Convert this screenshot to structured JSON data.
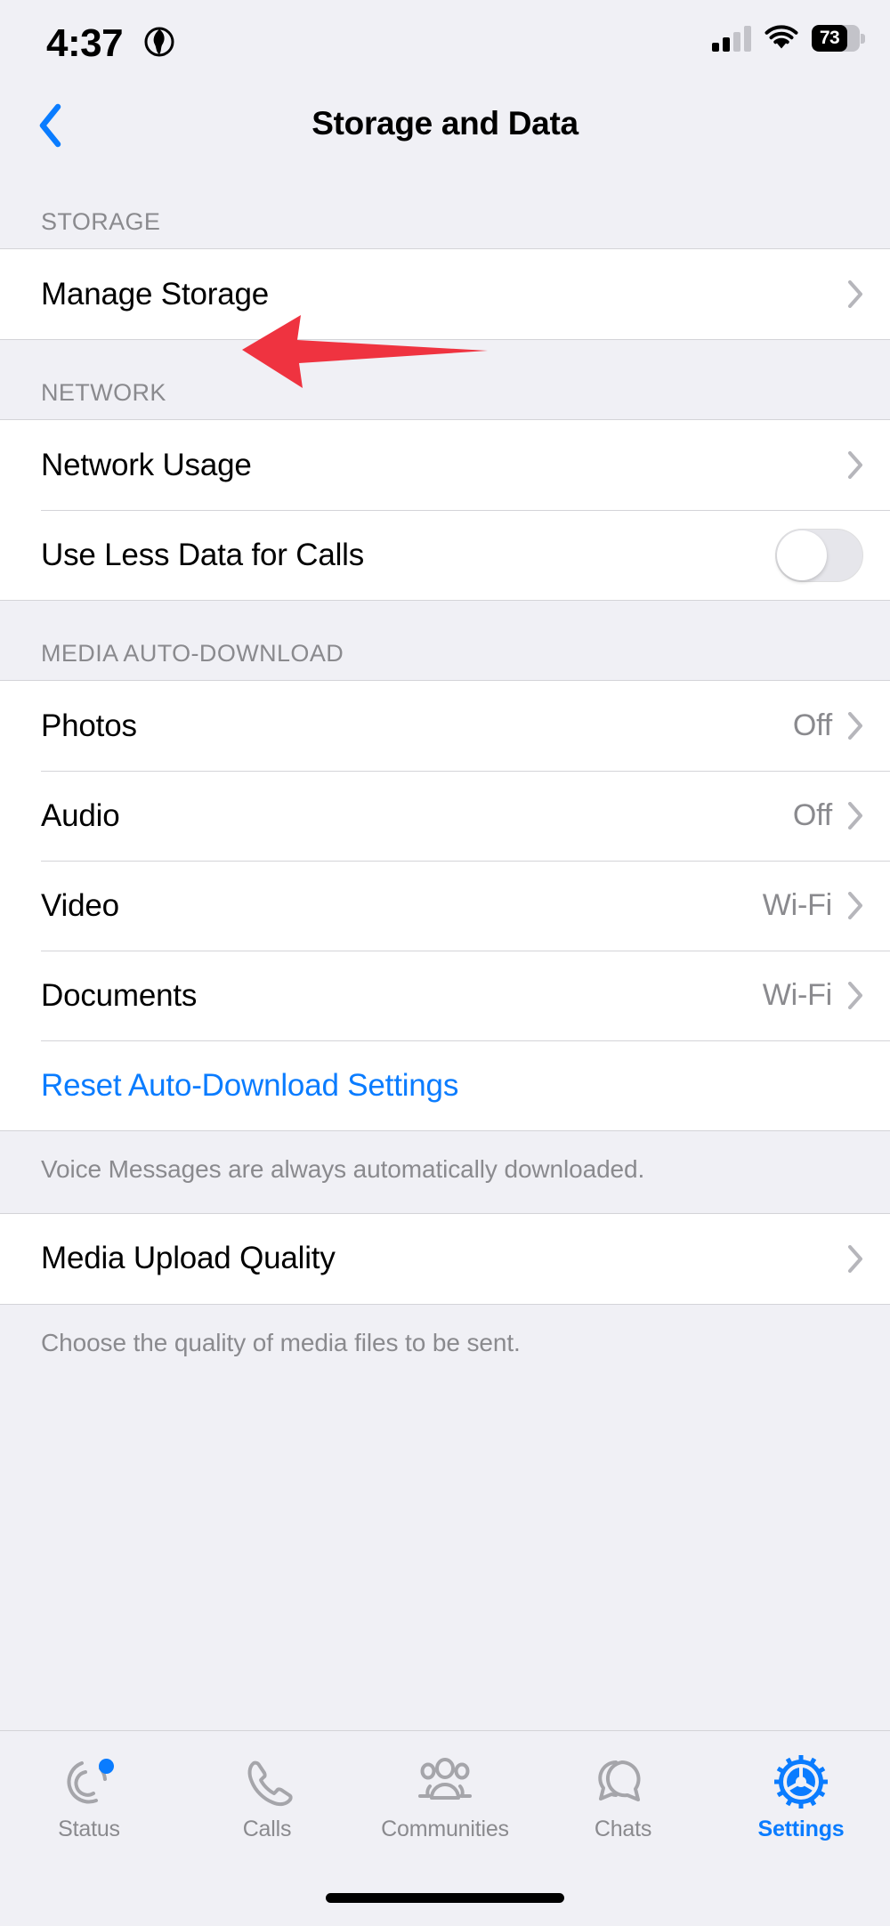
{
  "status_bar": {
    "time": "4:37",
    "location_icon": "location-services-icon",
    "signal_icon": "cellular-signal-icon",
    "signal_bars_filled": 2,
    "signal_bars_total": 4,
    "wifi_icon": "wifi-icon",
    "battery_percent": "73",
    "battery_icon": "battery-icon"
  },
  "nav": {
    "back_icon": "chevron-left-icon",
    "title": "Storage and Data"
  },
  "sections": {
    "storage": {
      "header": "STORAGE",
      "rows": [
        {
          "label": "Manage Storage",
          "value": "",
          "accessory": "chevron-right-icon"
        }
      ]
    },
    "network": {
      "header": "NETWORK",
      "rows": [
        {
          "label": "Network Usage",
          "value": "",
          "accessory": "chevron-right-icon"
        },
        {
          "label": "Use Less Data for Calls",
          "value": "",
          "accessory": "toggle-off"
        }
      ]
    },
    "media_auto_download": {
      "header": "MEDIA AUTO-DOWNLOAD",
      "rows": [
        {
          "label": "Photos",
          "value": "Off",
          "accessory": "chevron-right-icon"
        },
        {
          "label": "Audio",
          "value": "Off",
          "accessory": "chevron-right-icon"
        },
        {
          "label": "Video",
          "value": "Wi-Fi",
          "accessory": "chevron-right-icon"
        },
        {
          "label": "Documents",
          "value": "Wi-Fi",
          "accessory": "chevron-right-icon"
        },
        {
          "label": "Reset Auto-Download Settings",
          "value": "",
          "accessory": "none"
        }
      ],
      "footnote": "Voice Messages are always automatically downloaded."
    },
    "media_upload_quality": {
      "rows": [
        {
          "label": "Media Upload Quality",
          "value": "",
          "accessory": "chevron-right-icon"
        }
      ],
      "footnote": "Choose the quality of media files to be sent."
    }
  },
  "tabbar": {
    "tabs": [
      {
        "label": "Status",
        "icon": "status-rings-icon",
        "active": false,
        "badge": true
      },
      {
        "label": "Calls",
        "icon": "phone-icon",
        "active": false,
        "badge": false
      },
      {
        "label": "Communities",
        "icon": "communities-people-icon",
        "active": false,
        "badge": false
      },
      {
        "label": "Chats",
        "icon": "chat-bubbles-icon",
        "active": false,
        "badge": false
      },
      {
        "label": "Settings",
        "icon": "gear-icon",
        "active": true,
        "badge": false
      }
    ]
  },
  "annotation": {
    "arrow_icon": "red-left-arrow-annotation",
    "color": "#ef3340",
    "points_to": "Manage Storage"
  },
  "colors": {
    "accent_blue": "#0a7cff",
    "page_background": "#f0f0f5",
    "row_background": "#ffffff",
    "secondary_text": "#8a8a8e",
    "separator": "#d4d4d8",
    "annotation_red": "#ef3340"
  }
}
